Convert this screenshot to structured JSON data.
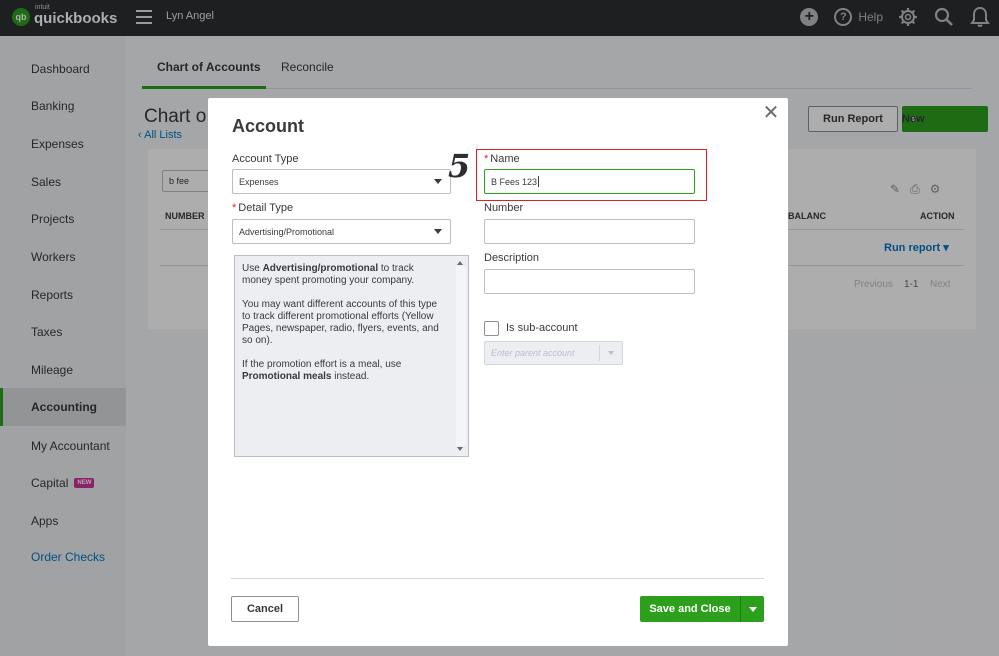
{
  "topbar": {
    "logo_intuit": "intuit",
    "logo_name": "quickbooks",
    "company": "Lyn Angel",
    "help_label": "Help",
    "icons": [
      "plus-icon",
      "help-icon",
      "gear-icon",
      "search-icon",
      "bell-icon"
    ]
  },
  "sidebar": {
    "items": [
      {
        "label": "Dashboard"
      },
      {
        "label": "Banking"
      },
      {
        "label": "Expenses"
      },
      {
        "label": "Sales"
      },
      {
        "label": "Projects"
      },
      {
        "label": "Workers"
      },
      {
        "label": "Reports"
      },
      {
        "label": "Taxes"
      },
      {
        "label": "Mileage"
      },
      {
        "label": "Accounting",
        "active": true
      },
      {
        "label": "My Accountant"
      },
      {
        "label": "Capital",
        "badge": "NEW"
      },
      {
        "label": "Apps"
      },
      {
        "label": "Order Checks",
        "link": true
      }
    ]
  },
  "main": {
    "tabs": [
      "Chart of Accounts",
      "Reconcile"
    ],
    "page_title": "Chart o",
    "all_lists": "All Lists",
    "run_report_button": "Run Report",
    "new_button": "New",
    "filter_value": "b fee",
    "columns": [
      "NUMBER",
      "BALANC",
      "ACTION"
    ],
    "row_action": "Run report",
    "pager": {
      "previous": "Previous",
      "range": "1-1",
      "next": "Next"
    }
  },
  "modal": {
    "title": "Account",
    "account_type_label": "Account Type",
    "account_type_value": "Expenses",
    "detail_type_label": "Detail Type",
    "detail_type_value": "Advertising/Promotional",
    "description_text": {
      "p1_pre": "Use ",
      "p1_bold": "Advertising/promotional",
      "p1_post": " to track money spent promoting your company.",
      "p2": "You may want different accounts of this type to track different promotional efforts (Yellow Pages, newspaper, radio, flyers, events, and so on).",
      "p3_pre": "If the promotion effort is a meal, use ",
      "p3_bold": "Promotional meals",
      "p3_post": " instead."
    },
    "name_label": "Name",
    "name_value": "B Fees 123",
    "number_label": "Number",
    "number_value": "",
    "description_label": "Description",
    "description_value": "",
    "subaccount_label": "Is sub-account",
    "parent_placeholder": "Enter parent account",
    "step_badge": "5",
    "cancel_button": "Cancel",
    "save_button": "Save and Close"
  },
  "colors": {
    "brand_green": "#2ca01c",
    "topbar": "#2d2e31",
    "link_blue": "#0077c5",
    "highlight_red": "#e02020"
  }
}
